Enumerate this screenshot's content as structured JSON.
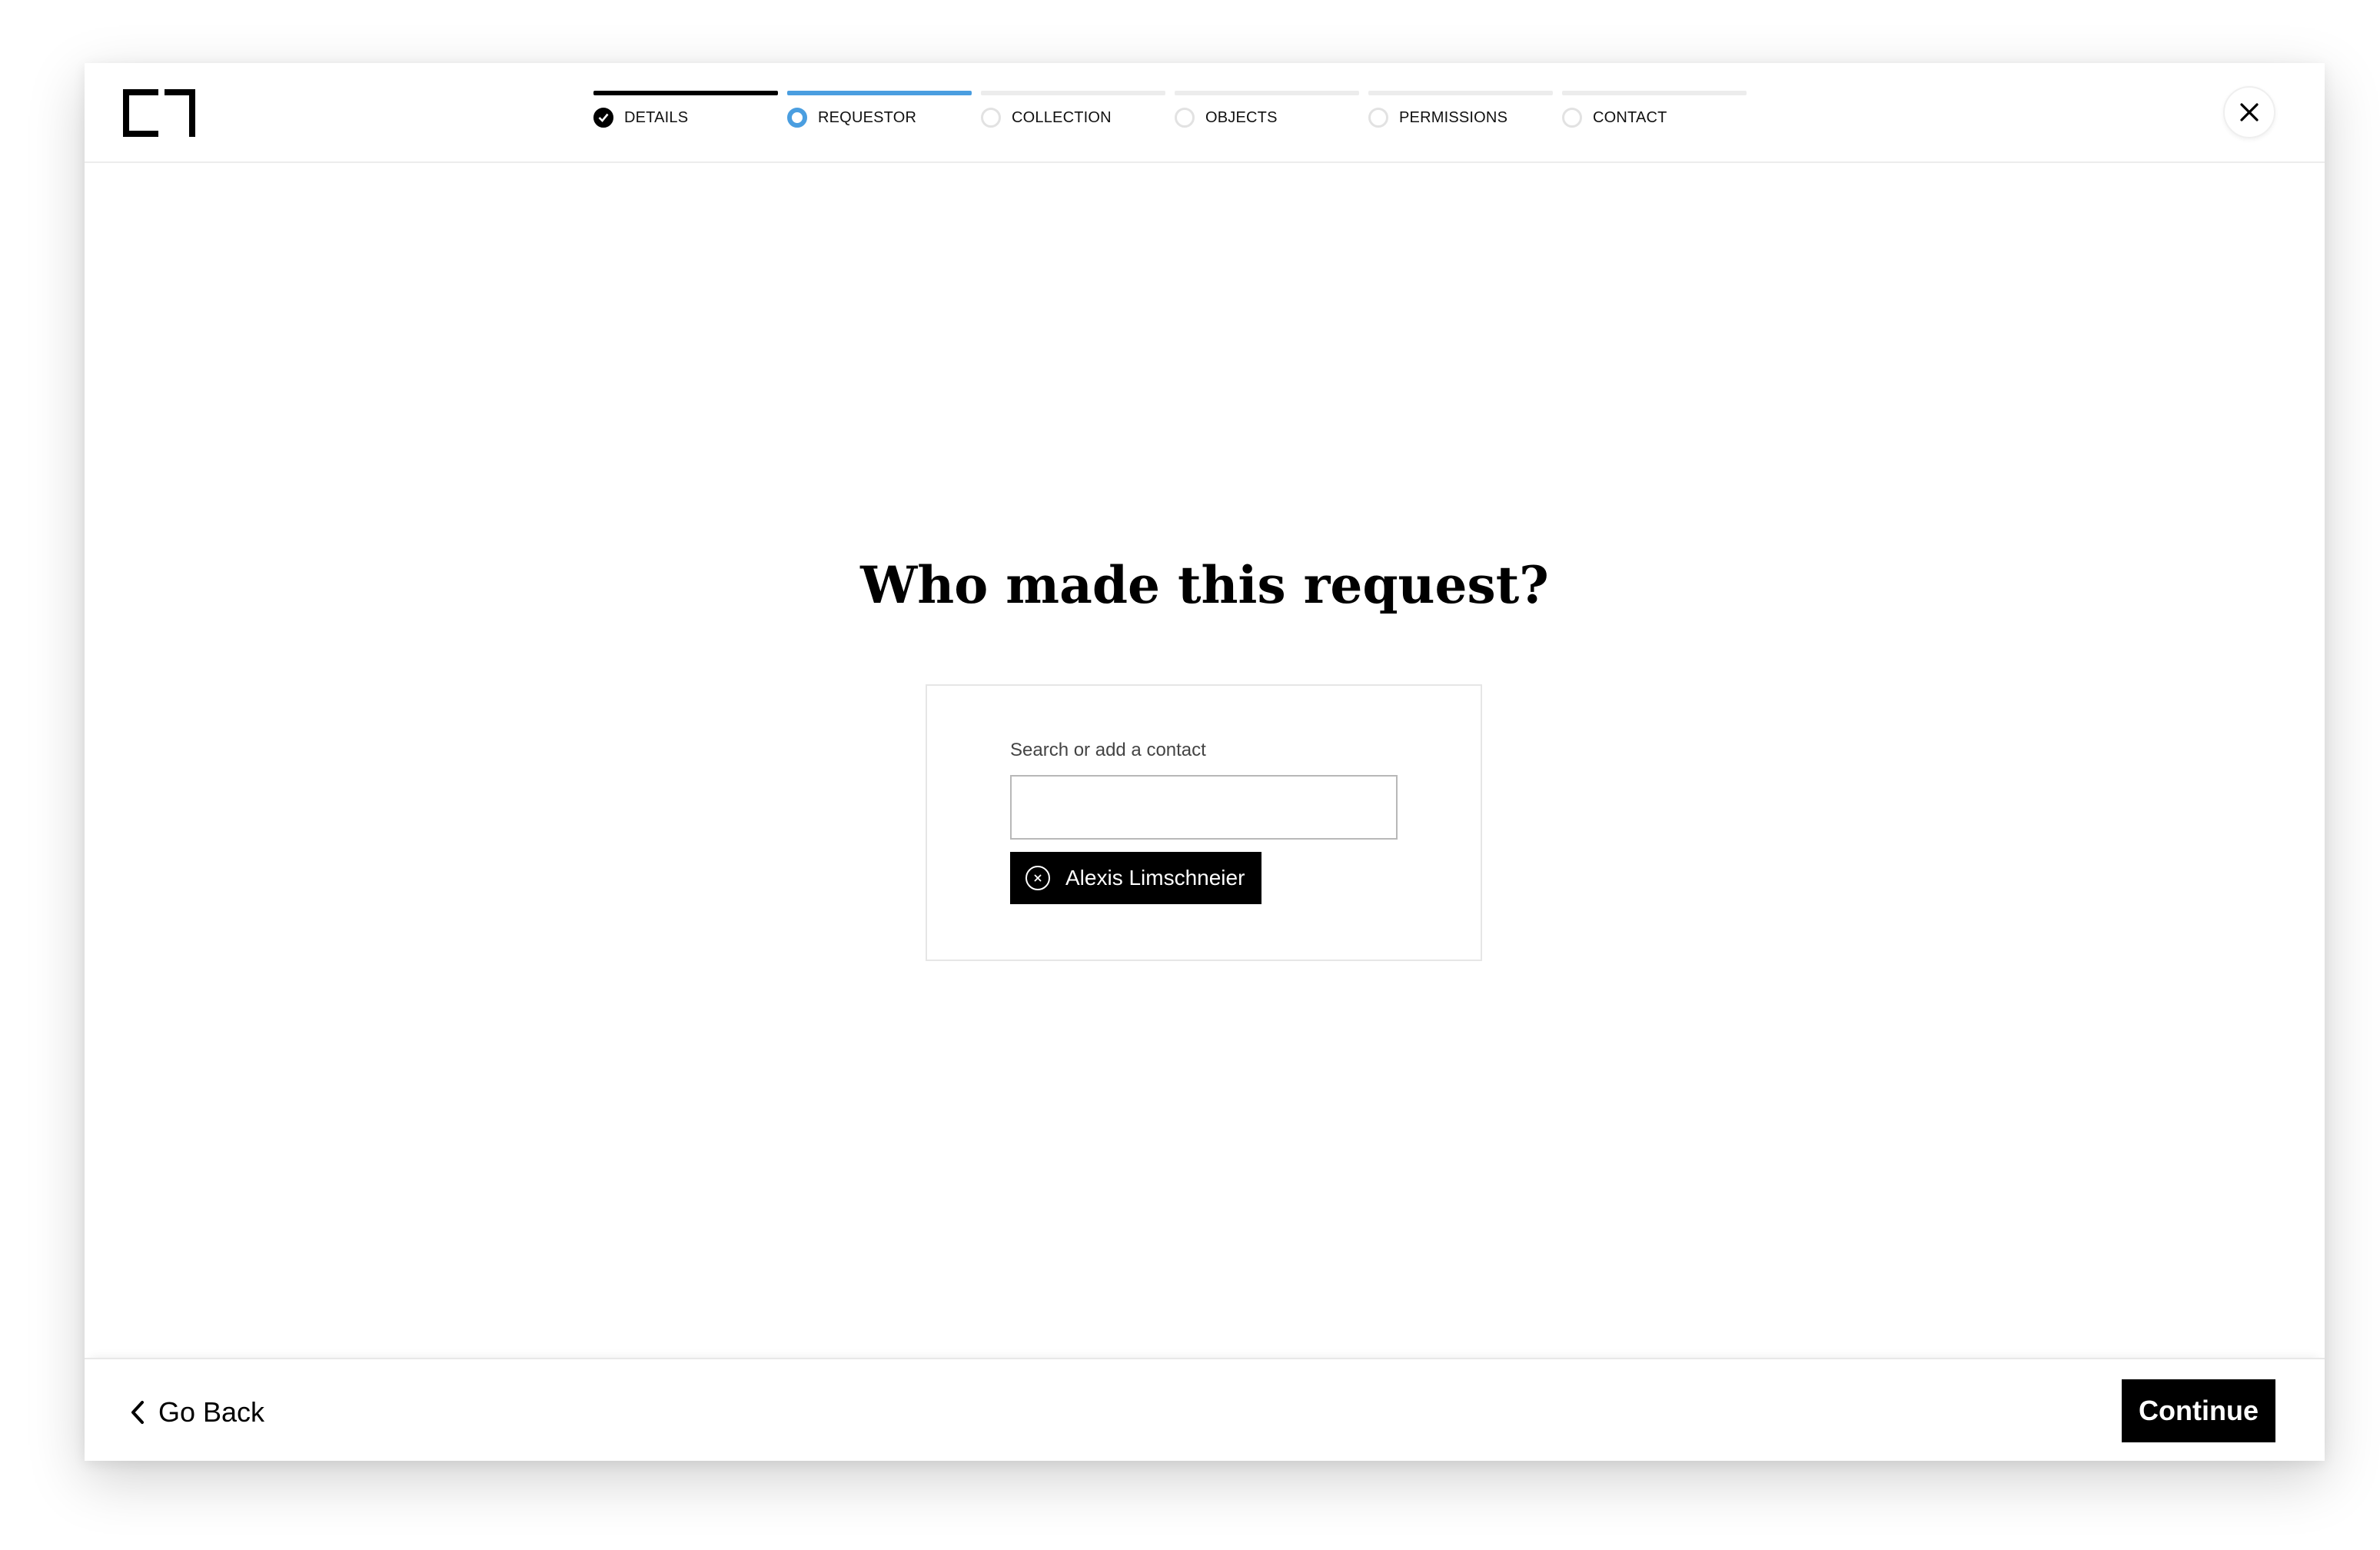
{
  "header": {
    "logo_icon": "bracket-logo-icon",
    "close_icon": "close-icon",
    "steps": [
      {
        "label": "DETAILS",
        "state": "done"
      },
      {
        "label": "REQUESTOR",
        "state": "current"
      },
      {
        "label": "COLLECTION",
        "state": "pending"
      },
      {
        "label": "OBJECTS",
        "state": "pending"
      },
      {
        "label": "PERMISSIONS",
        "state": "pending"
      },
      {
        "label": "CONTACT",
        "state": "pending"
      }
    ]
  },
  "main": {
    "title": "Who made this request?",
    "field_label": "Search or add a contact",
    "search_value": "",
    "selected_contact": "Alexis Limschneier",
    "remove_icon": "remove-circle-icon"
  },
  "footer": {
    "back_label": "Go Back",
    "back_icon": "chevron-left-icon",
    "continue_label": "Continue"
  },
  "colors": {
    "accent": "#4a9ee0",
    "primary": "#000000",
    "pending": "#e2e2e2"
  }
}
